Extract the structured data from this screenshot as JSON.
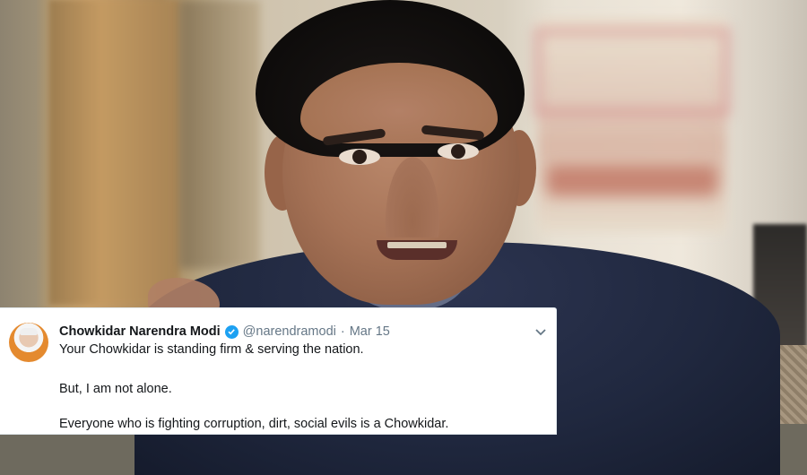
{
  "tweet": {
    "author_name": "Chowkidar Narendra Modi",
    "handle": "@narendramodi",
    "separator": "·",
    "date": "Mar 15",
    "lines": [
      "Your Chowkidar is standing firm & serving the nation.",
      "But, I am not alone.",
      "Everyone who is fighting corruption, dirt, social evils is a Chowkidar."
    ]
  },
  "colors": {
    "verified_badge": "#1da1f2",
    "name_text": "#14171a",
    "meta_text": "#657786",
    "card_bg": "#ffffff",
    "suit": "#20283f"
  },
  "icons": {
    "verified": "verified-badge-icon",
    "menu": "chevron-down-icon",
    "avatar": "profile-avatar"
  }
}
